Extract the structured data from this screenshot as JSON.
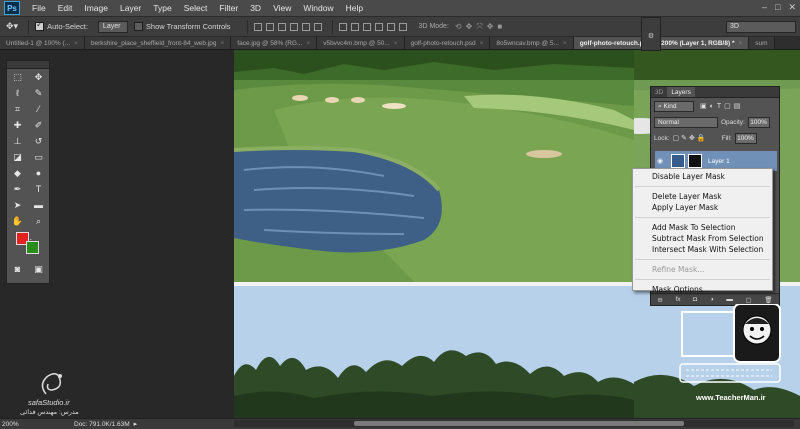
{
  "app": {
    "logo": "Ps",
    "menu": [
      "File",
      "Edit",
      "Image",
      "Layer",
      "Type",
      "Select",
      "Filter",
      "3D",
      "View",
      "Window",
      "Help"
    ]
  },
  "options": {
    "auto_select_label": "Auto-Select:",
    "auto_select_value": "Layer",
    "transform_label": "Show Transform Controls",
    "mode_3d_label": "3D Mode:",
    "workspace": "3D"
  },
  "tabs": [
    {
      "label": "Untitled-1 @ 100% (...",
      "active": false
    },
    {
      "label": "berkshire_place_sheffield_front-84_web.jpg",
      "active": false
    },
    {
      "label": "face.jpg @ 58% (RG...",
      "active": false
    },
    {
      "label": "v5bvvc4m.bmp @ 50...",
      "active": false
    },
    {
      "label": "golf-photo-retouch.psd",
      "active": false
    },
    {
      "label": "8o5wncav.bmp @ 5...",
      "active": false
    },
    {
      "label": "golf-photo-retouch.psd @ 200% (Layer 1, RGB/8) *",
      "active": true
    },
    {
      "label": "sum",
      "active": false
    }
  ],
  "layers_panel": {
    "tab_3d": "3D",
    "tab_layers": "Layers",
    "kind_label": "Kind",
    "blend_mode": "Normal",
    "opacity_label": "Opacity:",
    "opacity_value": "100%",
    "lock_label": "Lock:",
    "fill_label": "Fill:",
    "fill_value": "100%",
    "layer_name": "Layer 1"
  },
  "context_menu": {
    "items": [
      {
        "label": "Disable Layer Mask",
        "enabled": true
      },
      {
        "sep": true
      },
      {
        "label": "Delete Layer Mask",
        "enabled": true
      },
      {
        "label": "Apply Layer Mask",
        "enabled": true
      },
      {
        "sep": true
      },
      {
        "label": "Add Mask To Selection",
        "enabled": true
      },
      {
        "label": "Subtract Mask From Selection",
        "enabled": true
      },
      {
        "label": "Intersect Mask With Selection",
        "enabled": true
      },
      {
        "sep": true
      },
      {
        "label": "Refine Mask...",
        "enabled": false
      },
      {
        "sep": true
      },
      {
        "label": "Mask Options...",
        "enabled": true
      }
    ]
  },
  "status": {
    "zoom": "200%",
    "doc": "Doc: 791.0K/1.63M"
  },
  "watermarks": {
    "left_name": "safaStudio.ir",
    "left_sub": "مدرس: مهندس فدائی",
    "right_url": "www.TeacherMan.ir"
  },
  "colors": {
    "foreground": "#e52222",
    "background": "#2a8c1a",
    "selection": "#7090b8"
  }
}
